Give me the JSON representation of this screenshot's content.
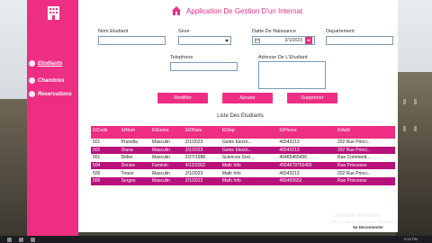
{
  "app": {
    "title": "Application De Gestion D'un Internat"
  },
  "sidebar": {
    "items": [
      {
        "label": "Etudiants",
        "active": true
      },
      {
        "label": "Chambres",
        "active": false
      },
      {
        "label": "Reservations",
        "active": false
      }
    ]
  },
  "form": {
    "nom_label": "Nom Etudiant",
    "nom_value": "",
    "sexe_label": "Sexe",
    "sexe_value": "",
    "date_label": "Datte De Naissance",
    "date_value": "2/1/2023",
    "departement_label": "Departement",
    "departement_value": "",
    "telephone_label": "Telephone",
    "telephone_value": "",
    "adresse_label": "Adresse De L'Etudiant",
    "adresse_value": ""
  },
  "buttons": {
    "modifier": "Modifier",
    "ajouter": "Ajouter",
    "supprimer": "Supprimer"
  },
  "list": {
    "title": "Liste Des Etudiants",
    "columns": [
      "EtCode",
      "EtNom",
      "EtGenre",
      "EtDNais",
      "EtDep",
      "EtPhone",
      "EtAdd"
    ],
    "rows": [
      [
        "501",
        "Prunella",
        "Masculin",
        "2/1/2023",
        "Genie Electri...",
        "46543213",
        "202 Rue Princi..."
      ],
      [
        "502",
        "Diana",
        "Masculin",
        "2/1/2023",
        "Genie Electri...",
        "46543213",
        "202 Rue Princi..."
      ],
      [
        "501",
        "Didier",
        "Masculin",
        "2/27/1998",
        "Sciences Soci...",
        "46465465456",
        "Rue Commerti..."
      ],
      [
        "504",
        "Denise",
        "Feminin",
        "4/12/2002",
        "Math Info",
        "4564679765456",
        "Rue Princesse"
      ],
      [
        "505",
        "Tresor",
        "Masculin",
        "2/1/2023",
        "Math Info",
        "46543213",
        "202 Rue Princi..."
      ],
      [
        "506",
        "Serges",
        "Masculin",
        "2/1/2023",
        "Math Info",
        "465465652",
        "Rue Princesse"
      ]
    ]
  },
  "footer": {
    "watermark_title": "Activate Windows",
    "watermark_sub": "Go to Settings to activate Windows.",
    "disconnect_label": "Se Deconnecter",
    "clock": "9:15 PM"
  },
  "colors": {
    "accent": "#ee2e83",
    "row_dark": "#b8127a"
  },
  "icons": [
    "building-icon",
    "home-icon",
    "calendar-icon",
    "chevron-down-icon"
  ]
}
